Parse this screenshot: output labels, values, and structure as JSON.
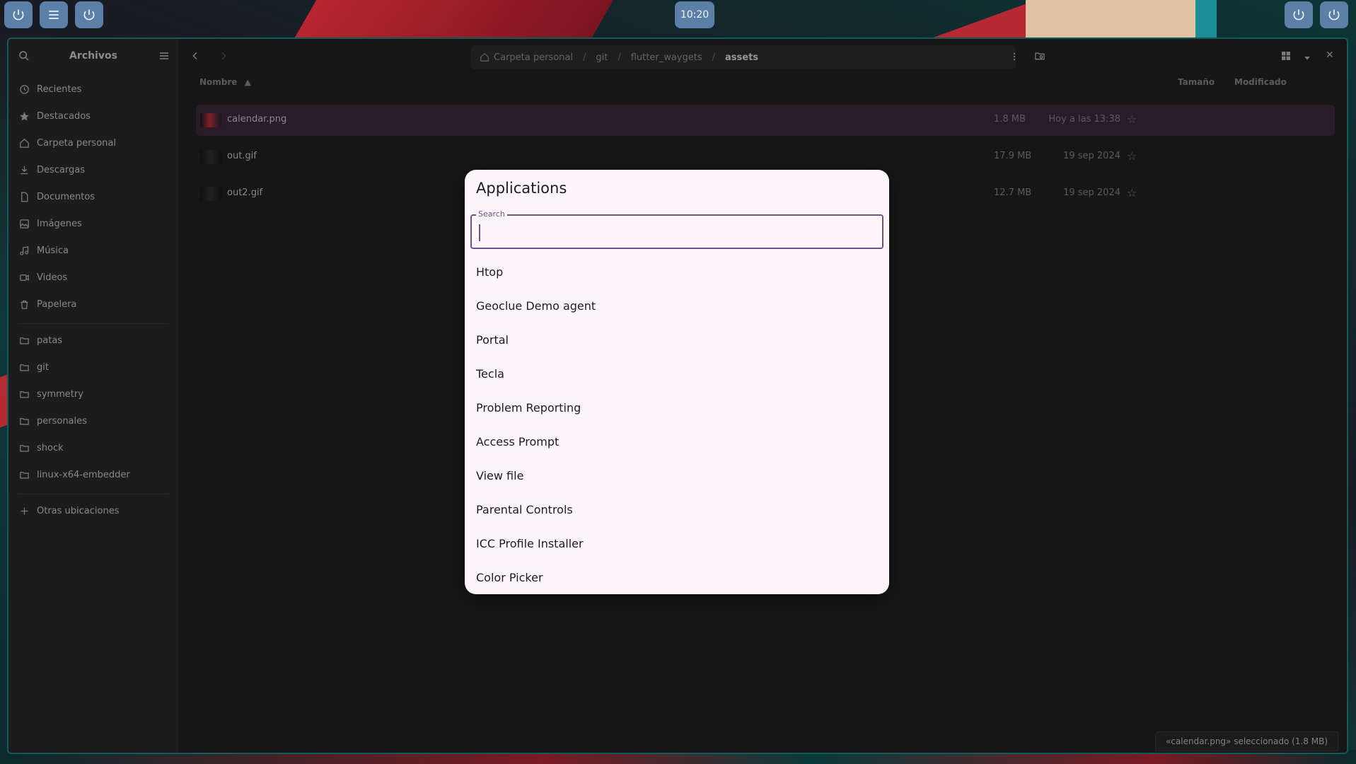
{
  "panel": {
    "clock": "10:20"
  },
  "sidebar": {
    "title": "Archivos",
    "places": [
      {
        "label": "Recientes",
        "icon": "clock-icon"
      },
      {
        "label": "Destacados",
        "icon": "star-icon"
      },
      {
        "label": "Carpeta personal",
        "icon": "home-icon"
      },
      {
        "label": "Descargas",
        "icon": "download-icon"
      },
      {
        "label": "Documentos",
        "icon": "document-icon"
      },
      {
        "label": "Imágenes",
        "icon": "image-icon"
      },
      {
        "label": "Música",
        "icon": "music-icon"
      },
      {
        "label": "Videos",
        "icon": "video-icon"
      },
      {
        "label": "Papelera",
        "icon": "trash-icon"
      }
    ],
    "bookmarks": [
      {
        "label": "patas"
      },
      {
        "label": "git"
      },
      {
        "label": "symmetry"
      },
      {
        "label": "personales"
      },
      {
        "label": "shock"
      },
      {
        "label": "linux-x64-embedder"
      }
    ],
    "other_locations": "Otras ubicaciones"
  },
  "path": {
    "segments": [
      "Carpeta personal",
      "git",
      "flutter_waygets"
    ],
    "current": "assets"
  },
  "columns": {
    "name": "Nombre",
    "size": "Tamaño",
    "modified": "Modificado"
  },
  "files": [
    {
      "name": "calendar.png",
      "size": "1.8 MB",
      "modified": "Hoy a las 13:38",
      "selected": true
    },
    {
      "name": "out.gif",
      "size": "17.9 MB",
      "modified": "19 sep 2024",
      "selected": false
    },
    {
      "name": "out2.gif",
      "size": "12.7 MB",
      "modified": "19 sep 2024",
      "selected": false
    }
  ],
  "status": "«calendar.png» seleccionado  (1.8 MB)",
  "dialog": {
    "title": "Applications",
    "search_label": "Search",
    "search_value": "",
    "apps": [
      "Htop",
      "Geoclue Demo agent",
      "Portal",
      "Tecla",
      "Problem Reporting",
      "Access Prompt",
      "View file",
      "Parental Controls",
      "ICC Profile Installer",
      "Color Picker"
    ]
  }
}
